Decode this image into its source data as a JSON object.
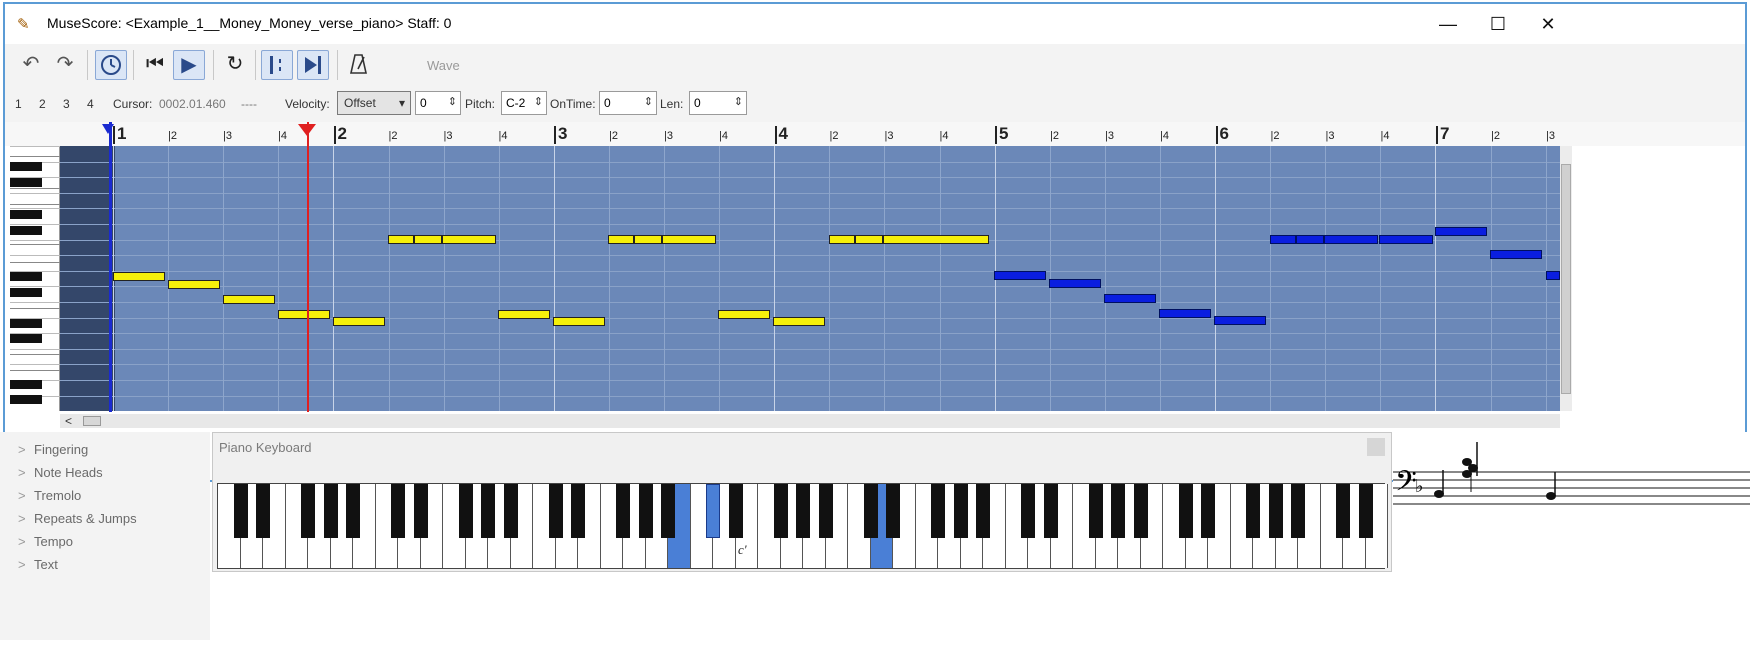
{
  "window": {
    "title": "MuseScore: <Example_1__Money_Money_verse_piano> Staff: 0",
    "minimize": "—",
    "maximize": "☐",
    "close": "✕"
  },
  "toolbar": {
    "undo_icon": "↶",
    "redo_icon": "↷",
    "rewind_icon": "⏮",
    "play_icon": "▶",
    "loop_icon": "↻",
    "wave_label": "Wave"
  },
  "controls": {
    "voices": [
      "1",
      "2",
      "3",
      "4"
    ],
    "cursor_label": "Cursor:",
    "cursor_value": "0002.01.460",
    "cursor_dashes": "----",
    "velocity_label": "Velocity:",
    "velocity_mode": "Offset",
    "velocity_value": "0",
    "pitch_label": "Pitch:",
    "pitch_value": "C-2",
    "ontime_label": "OnTime:",
    "ontime_value": "0",
    "len_label": "Len:",
    "len_value": "0"
  },
  "ruler": {
    "measures": [
      "1",
      "2",
      "3",
      "4",
      "5",
      "6",
      "7"
    ],
    "beats": [
      "2",
      "3",
      "4"
    ]
  },
  "palette": {
    "items": [
      "Fingering",
      "Note Heads",
      "Tremolo",
      "Repeats & Jumps",
      "Tempo",
      "Text"
    ]
  },
  "piano_keyboard": {
    "title": "Piano Keyboard",
    "middle_c_label": "c'"
  },
  "colors": {
    "selected_note": "#f5f00a",
    "unselected_note": "#0a1ee0",
    "grid_bg": "#6b88b8",
    "playhead": "#e02020",
    "highlight_key": "#4a7fd6"
  }
}
